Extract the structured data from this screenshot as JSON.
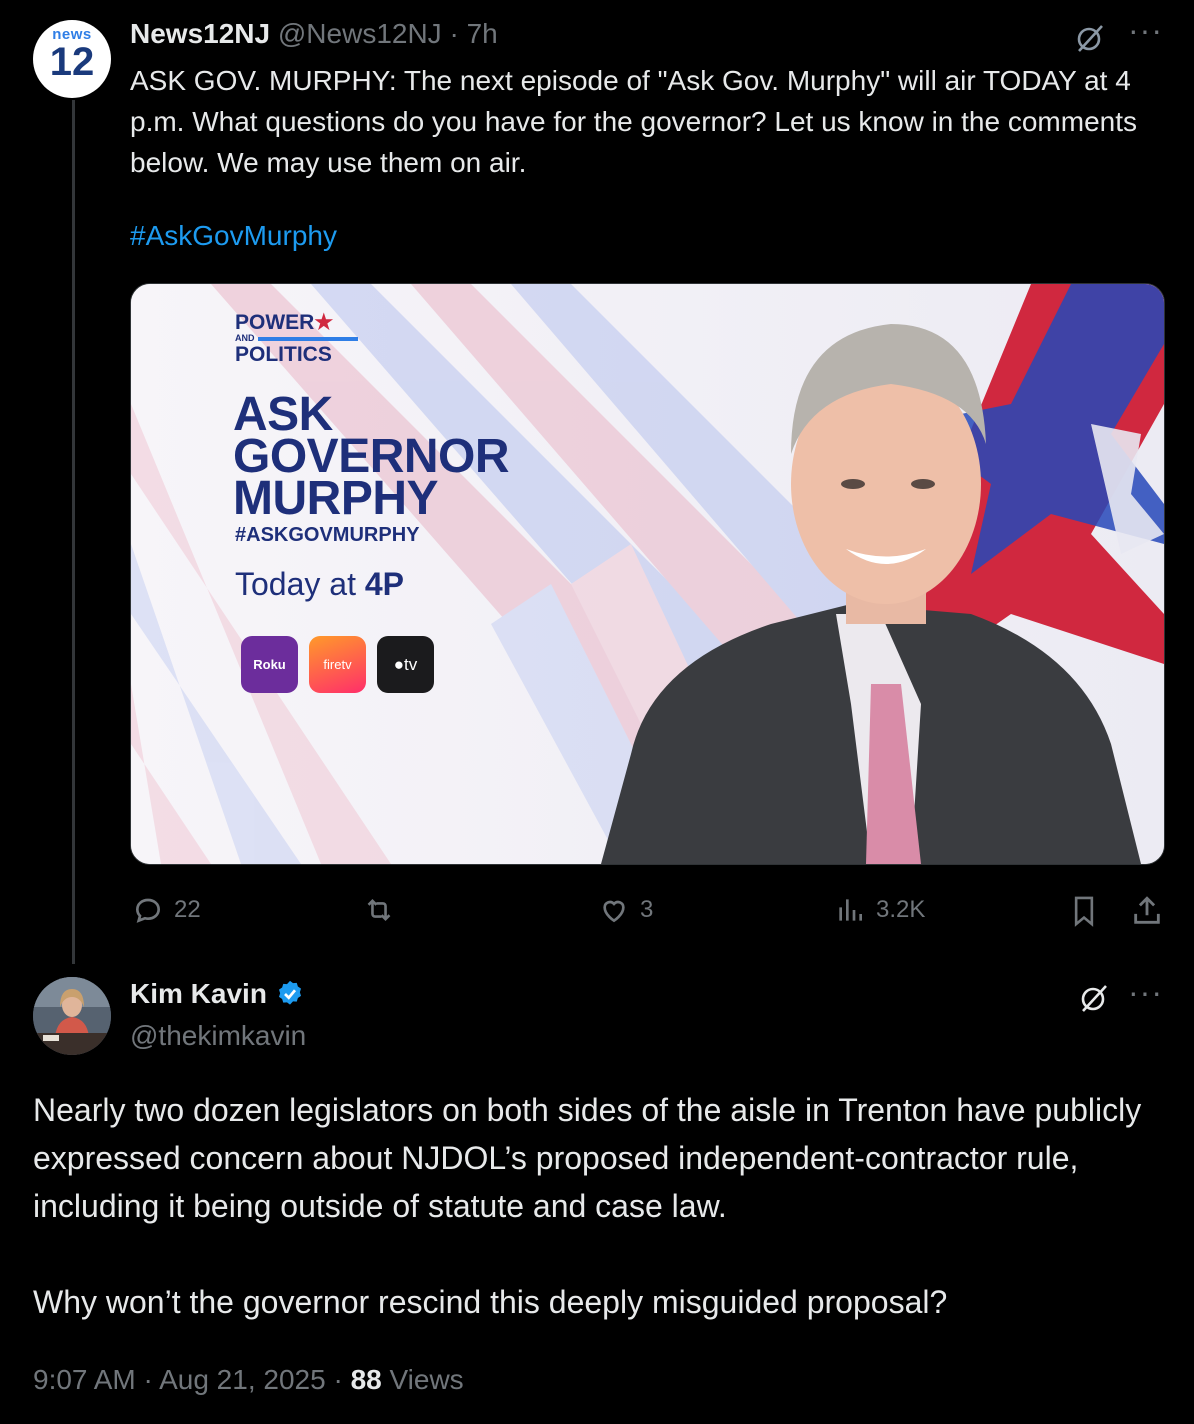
{
  "tweet1": {
    "avatar_text_top": "news",
    "avatar_text_num": "12",
    "display_name": "News12NJ",
    "handle": "@News12NJ",
    "time": "· 7h",
    "text": "ASK GOV. MURPHY: The next episode of \"Ask Gov. Murphy\" will air TODAY at 4 p.m. What questions do you have for the governor? Let us know in the comments below. We may use them on air.",
    "hashtag": "#AskGovMurphy",
    "media": {
      "brand_top": "POWER",
      "brand_and": "AND",
      "brand_bottom": "POLITICS",
      "title_lines": [
        "ASK",
        "GOVERNOR",
        "MURPHY"
      ],
      "hashtag": "#ASKGOVMURPHY",
      "time_prefix": "Today at ",
      "time_bold": "4P",
      "app_roku": "Roku",
      "app_firetv": "firetv",
      "app_appletv": "tv"
    },
    "actions": {
      "replies": "22",
      "retweets": "",
      "likes": "3",
      "views": "3.2K"
    }
  },
  "tweet2": {
    "display_name": "Kim Kavin",
    "handle": "@thekimkavin",
    "paragraph1": "Nearly two dozen legislators on both sides of the aisle in Trenton have publicly expressed concern about NJDOL’s proposed independent-contractor rule, including it being outside of statute and case law.",
    "paragraph2": "Why won’t the governor rescind this deeply misguided proposal?",
    "time": "9:07 AM",
    "sep1": " · ",
    "date": "Aug 21, 2025",
    "sep2": " · ",
    "views_count": "88",
    "views_label": " Views"
  },
  "colors": {
    "background": "#000000",
    "text": "#e7e9ea",
    "muted": "#71767b",
    "link": "#1d9bf0",
    "verified": "#1d9bf0"
  },
  "icons": [
    "grok-icon",
    "more-icon",
    "reply-icon",
    "retweet-icon",
    "like-icon",
    "views-icon",
    "bookmark-icon",
    "share-icon",
    "verified-badge-icon"
  ]
}
